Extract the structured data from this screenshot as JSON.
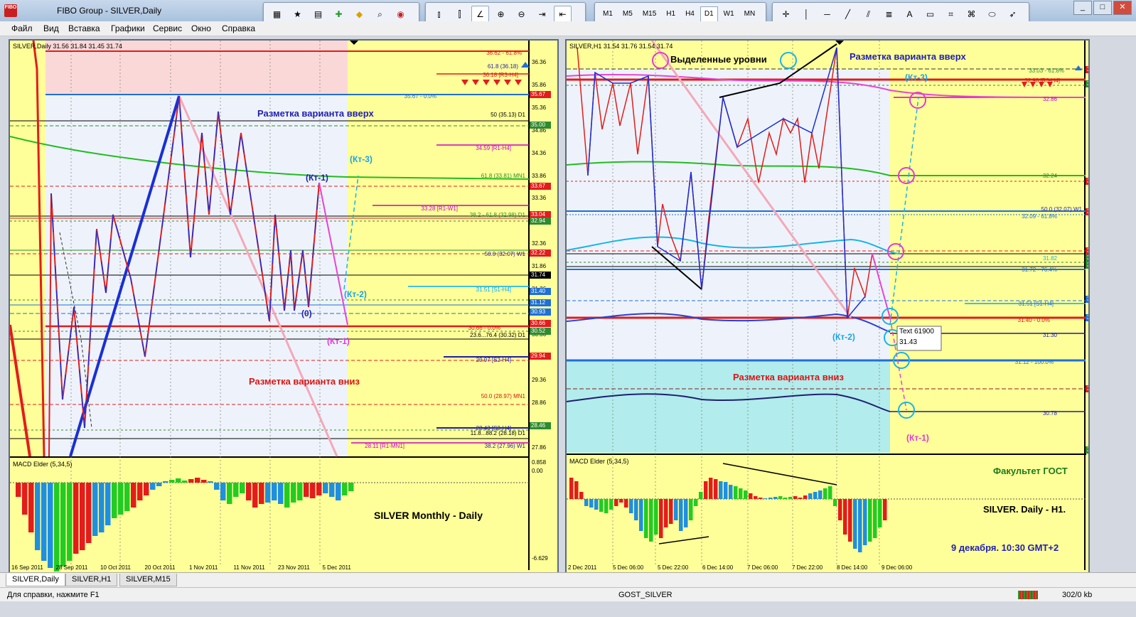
{
  "window": {
    "title": "FIBO Group - SILVER,Daily",
    "icon_text": "FIBO"
  },
  "menu": [
    "Файл",
    "Вид",
    "Вставка",
    "Графики",
    "Сервис",
    "Окно",
    "Справка"
  ],
  "timeframes": [
    "M1",
    "M5",
    "M15",
    "H1",
    "H4",
    "D1",
    "W1",
    "MN"
  ],
  "active_timeframe": "D1",
  "left_chart": {
    "header": "SILVER,Daily  31.56 31.84 31.45 31.74",
    "label_up": "Разметка варианта вверх",
    "label_down": "Разметка варианта вниз",
    "wave_labels": {
      "kt1_top": "(Кт-1)",
      "kt3": "(Кт-3)",
      "kt2": "(Кт-2)",
      "zero": "(0)",
      "kt1_bottom": "(Кт-1)"
    },
    "levels": [
      {
        "t": "36.62 - 61.8%"
      },
      {
        "t": "61.8 (36.18)"
      },
      {
        "t": "36.18 [R3-H4]"
      },
      {
        "t": "35.67 - 0.0%"
      },
      {
        "t": "50 (35.13) D1"
      },
      {
        "t": "34.59 [R1-H4]"
      },
      {
        "t": "61.8 (33.81) MN1"
      },
      {
        "t": "33.28 [R1-W1]"
      },
      {
        "t": "38.2 - 61.8 (32.98) D1"
      },
      {
        "t": "50.0 (32.07) W1"
      },
      {
        "t": "31.51 [S1-H4]"
      },
      {
        "t": "30.66 - 0.0%"
      },
      {
        "t": "23.6...76.4 (30.32) D1"
      },
      {
        "t": "29.97 [S2-H4]"
      },
      {
        "t": "50.0 (28.97) MN1"
      },
      {
        "t": "28.43 [S3-H4]"
      },
      {
        "t": "11.8...88.2 (28.18) D1"
      },
      {
        "t": "28.11 [R1-MN1]"
      },
      {
        "t": "38.2 (27.96) W1"
      }
    ],
    "price_ticks": [
      "36.36",
      "35.86",
      "35.36",
      "34.86",
      "34.36",
      "33.86",
      "33.36",
      "32.86",
      "32.36",
      "31.86",
      "31.36",
      "30.86",
      "30.36",
      "29.86",
      "29.36",
      "28.86",
      "28.36",
      "27.86"
    ],
    "price_boxes": [
      {
        "t": "35.67",
        "c": "#e31c1c"
      },
      {
        "t": "35.00",
        "c": "#2e8b2e"
      },
      {
        "t": "33.67",
        "c": "#e31c1c"
      },
      {
        "t": "33.04",
        "c": "#e31c1c"
      },
      {
        "t": "32.94",
        "c": "#2e8b2e"
      },
      {
        "t": "32.22",
        "c": "#e31c1c"
      },
      {
        "t": "31.74",
        "c": "#000000"
      },
      {
        "t": "31.40",
        "c": "#1f6fd6"
      },
      {
        "t": "31.12",
        "c": "#1f6fd6"
      },
      {
        "t": "30.93",
        "c": "#1f6fd6"
      },
      {
        "t": "30.66",
        "c": "#e31c1c"
      },
      {
        "t": "30.52",
        "c": "#2e8b2e"
      },
      {
        "t": "29.94",
        "c": "#e31c1c"
      },
      {
        "t": "28.46",
        "c": "#2e8b2e"
      }
    ],
    "macd_header": "MACD Elder (5,34,5)",
    "macd_ticks": [
      "0.858",
      "0.00",
      "-6.629"
    ],
    "caption": "SILVER  Monthly - Daily",
    "dates": [
      "16 Sep 2011",
      "28 Sep 2011",
      "10 Oct 2011",
      "20 Oct 2011",
      "1 Nov 2011",
      "11 Nov 2011",
      "23 Nov 2011",
      "5 Dec 2011"
    ]
  },
  "right_chart": {
    "header": "SILVER,H1  31.54 31.76 31.54 31.74",
    "label_levels": "Выделенные уровни",
    "label_up": "Разметка варианта вверх",
    "label_down": "Разметка варианта вниз",
    "wave_labels": {
      "kt3": "(Кт-3)",
      "kt2": "(Кт-2)",
      "kt1": "(Кт-1)"
    },
    "tooltip": [
      "Text 61900",
      "31.43"
    ],
    "levels": [
      {
        "t": "33.03 - 61.8%"
      },
      {
        "t": "32.98 [R3-H4]"
      },
      {
        "t": "32.86"
      },
      {
        "t": "32.24"
      },
      {
        "t": "50.0 (32.07) W1"
      },
      {
        "t": "32.09 - 61.8%"
      },
      {
        "t": "31.82"
      },
      {
        "t": "31.72 - 76.4%"
      },
      {
        "t": "31.51 [S1-H4]"
      },
      {
        "t": "31.40 - 0.0%"
      },
      {
        "t": "31.30"
      },
      {
        "t": "31.12 - 100.0%"
      },
      {
        "t": "30.78"
      }
    ],
    "price_ticks": [
      "33.10",
      "32.95",
      "32.80",
      "32.65",
      "32.50",
      "32.35",
      "32.20",
      "32.05",
      "31.90",
      "31.75",
      "31.60",
      "31.45",
      "31.30",
      "31.15",
      "31.00",
      "30.85",
      "30.70",
      "30.55"
    ],
    "price_boxes": [
      {
        "t": "33.04",
        "c": "#e31c1c"
      },
      {
        "t": "32.94",
        "c": "#2e8b2e"
      },
      {
        "t": "32.30",
        "c": "#e31c1c"
      },
      {
        "t": "32.10",
        "c": "#e31c1c"
      },
      {
        "t": "31.84",
        "c": "#e31c1c"
      },
      {
        "t": "31.79",
        "c": "#2e8b2e"
      },
      {
        "t": "31.76",
        "c": "#2e8b2e"
      },
      {
        "t": "31.52",
        "c": "#1f6fd6"
      },
      {
        "t": "31.40",
        "c": "#1f6fd6"
      },
      {
        "t": "30.93",
        "c": "#e31c1c"
      },
      {
        "t": "30.52",
        "c": "#2e8b2e"
      }
    ],
    "macd_header": "MACD Elder (5,34,5)",
    "macd_ticks": [
      "0.00"
    ],
    "faculty": "Факультет ГОСТ",
    "caption1": "SILVER. Daily - H1.",
    "caption2": "9 декабря. 10:30 GMT+2",
    "dates": [
      "2 Dec 2011",
      "5 Dec 06:00",
      "5 Dec 22:00",
      "6 Dec 14:00",
      "7 Dec 06:00",
      "7 Dec 22:00",
      "8 Dec 14:00",
      "9 Dec 06:00"
    ]
  },
  "tabs": [
    "SILVER,Daily",
    "SILVER,H1",
    "SILVER,M15"
  ],
  "active_tab": "SILVER,Daily",
  "status": {
    "help": "Для справки, нажмите F1",
    "profile": "GOST_SILVER",
    "traffic": "302/0 kb"
  }
}
